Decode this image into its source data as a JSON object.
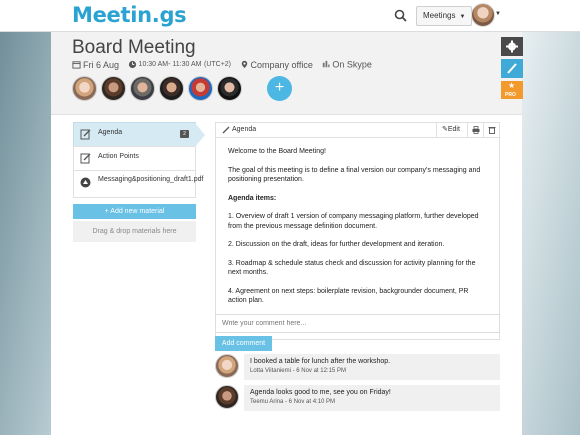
{
  "app": {
    "logo": "Meetin.gs",
    "meetings_label": "Meetings"
  },
  "meeting": {
    "title": "Board Meeting",
    "date": "Fri 6 Aug",
    "time": "10:30 AM- 11:30 AM",
    "timezone": "(UTC+2)",
    "location": "Company office",
    "online": "On Skype",
    "participants_count": 6
  },
  "materials": {
    "items": [
      {
        "label": "Agenda",
        "comments": "2"
      },
      {
        "label": "Action Points"
      },
      {
        "label": "Messaging&positioning_draft1.pdf"
      }
    ],
    "add_label": "Add new material",
    "drop_label": "Drag & drop materials here"
  },
  "agenda": {
    "tab_label": "Agenda",
    "edit_label": "Edit",
    "p1": "Welcome to the Board Meeting!",
    "p2": "The goal of this meeting is to define a final version our company's messaging and positioning presentation.",
    "p3": "Agenda items:",
    "p4": "1. Overview of draft 1 version of company messaging platform, further developed from the previous message definition document.",
    "p5": "2. Discussion on the draft, ideas for further development and iteration.",
    "p6": "3. Roadmap & schedule status check and discussion for activity planning for the next months.",
    "p7": "4. Agreement on next steps: boilerplate revision, backgrounder document, PR action plan."
  },
  "comment_input": {
    "placeholder": "Write your comment here...",
    "button_label": "Add comment"
  },
  "comments": [
    {
      "text": "I booked a table for lunch after the workshop.",
      "meta": "Lotta Viitaniemi - 6 Nov at 12:15 PM"
    },
    {
      "text": "Agenda looks good to me, see you on Friday!",
      "meta": "Teemu Arina - 6 Nov at 4:10 PM"
    }
  ],
  "side_tabs": {
    "pro_label": "PRO"
  },
  "colors": {
    "accent": "#4bb7e2",
    "brand": "#2aa3d2",
    "pro": "#f39a2d"
  }
}
